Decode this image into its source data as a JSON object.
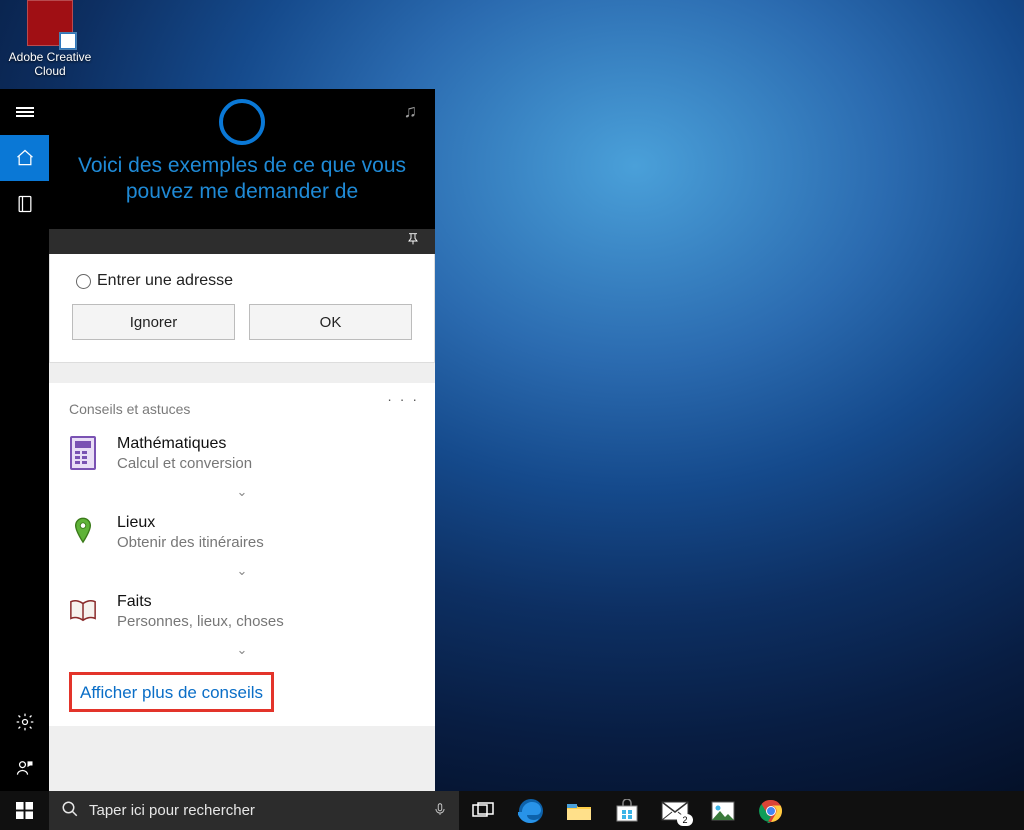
{
  "desktop": {
    "icon_label": "Adobe Creative Cloud"
  },
  "rail": {
    "items": [
      "menu",
      "home",
      "notebook"
    ],
    "bottom_items": [
      "settings",
      "feedback"
    ]
  },
  "hero": {
    "text": "Voici des exemples de ce que vous pouvez me demander de"
  },
  "address_card": {
    "radio_label": "Entrer une adresse",
    "ignore": "Ignorer",
    "ok": "OK"
  },
  "tips": {
    "heading": "Conseils et astuces",
    "items": [
      {
        "title": "Mathématiques",
        "sub": "Calcul et conversion",
        "icon": "calculator"
      },
      {
        "title": "Lieux",
        "sub": "Obtenir des itinéraires",
        "icon": "pin"
      },
      {
        "title": "Faits",
        "sub": "Personnes, lieux, choses",
        "icon": "book"
      }
    ],
    "more": "Afficher plus de conseils"
  },
  "taskbar": {
    "search_placeholder": "Taper ici pour rechercher",
    "mail_badge": "2"
  }
}
